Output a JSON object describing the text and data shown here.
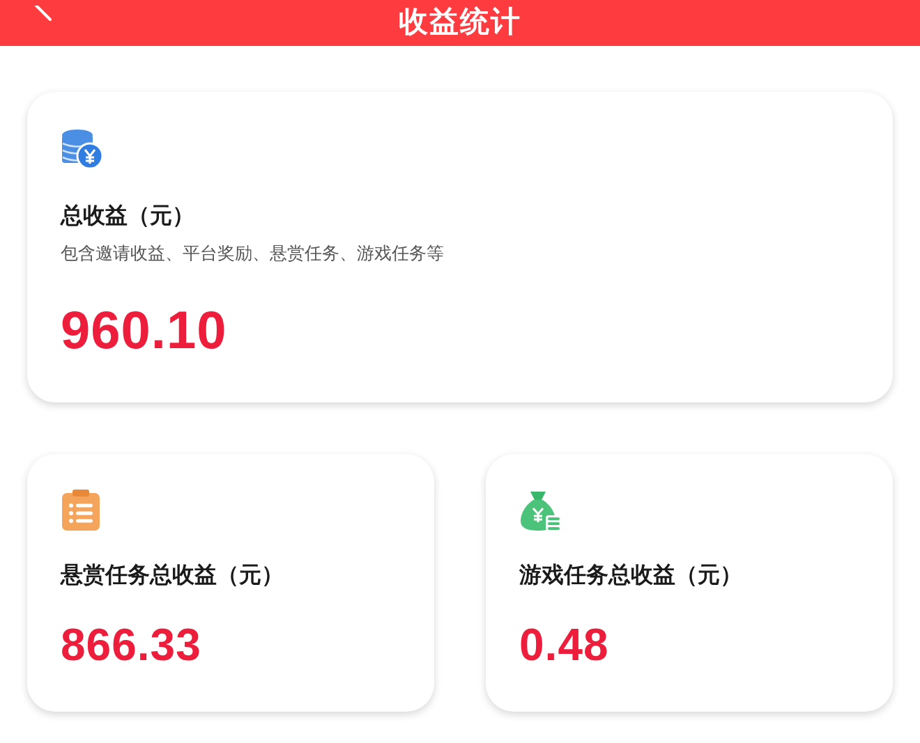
{
  "header": {
    "title": "收益统计"
  },
  "total": {
    "title": "总收益（元）",
    "description": "包含邀请收益、平台奖励、悬赏任务、游戏任务等",
    "amount": "960.10"
  },
  "cards": [
    {
      "title": "悬赏任务总收益（元）",
      "amount": "866.33"
    },
    {
      "title": "游戏任务总收益（元）",
      "amount": "0.48"
    }
  ]
}
